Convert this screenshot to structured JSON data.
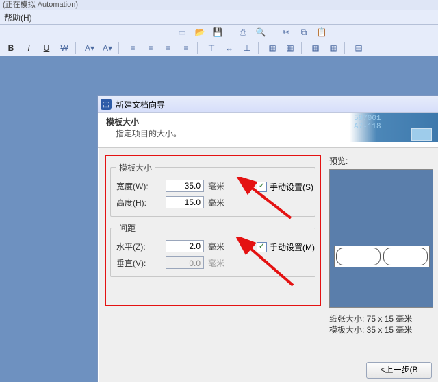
{
  "app": {
    "title_fragment": "(正在模拟 Automation)",
    "menu": {
      "help": "帮助(H)"
    }
  },
  "dialog": {
    "title": "新建文档向导",
    "banner": {
      "title": "模板大小",
      "sub": "指定项目的大小。",
      "code1": "597001",
      "code2": "A7-118"
    },
    "size": {
      "legend": "模板大小",
      "width_label": "宽度(W):",
      "width_value": "35.0",
      "width_unit": "毫米",
      "height_label": "高度(H):",
      "height_value": "15.0",
      "height_unit": "毫米",
      "manual_label": "手动设置(S)",
      "manual_checked": true
    },
    "gap": {
      "legend": "间距",
      "hor_label": "水平(Z):",
      "hor_value": "2.0",
      "hor_unit": "毫米",
      "ver_label": "垂直(V):",
      "ver_value": "0.0",
      "ver_unit": "毫米",
      "manual_label": "手动设置(M)",
      "manual_checked": true
    },
    "preview": {
      "label": "预览:",
      "paper_info": "纸张大小: 75 x 15 毫米",
      "tpl_info": "模板大小: 35 x 15 毫米"
    },
    "buttons": {
      "back": "<上一步(B"
    }
  }
}
